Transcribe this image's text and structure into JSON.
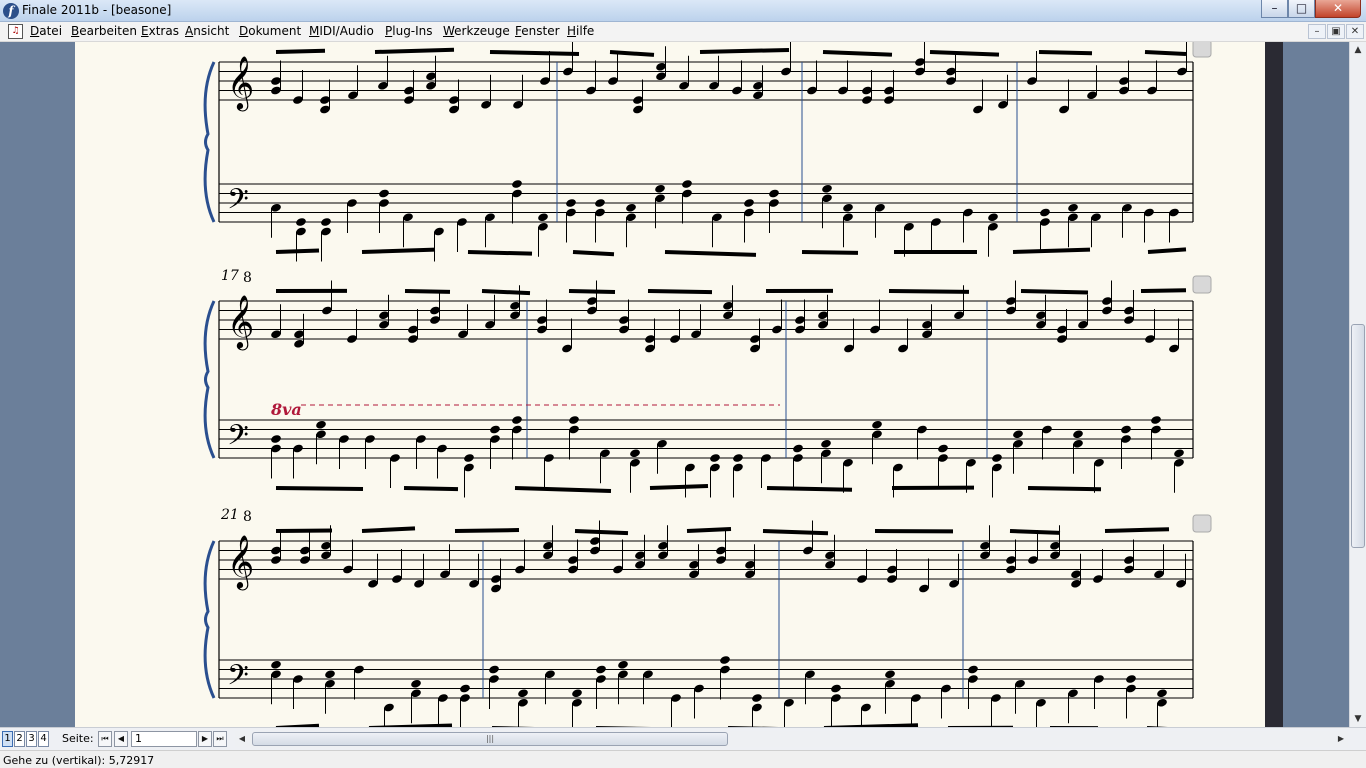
{
  "window": {
    "title": "Finale 2011b - [beasone]",
    "app_icon_glyph": "f",
    "minimize": "–",
    "maximize": "□",
    "close": "✕"
  },
  "menu": {
    "doc_icon": "doc-icon",
    "items": [
      "Datei",
      "Bearbeiten",
      "Extras",
      "Ansicht",
      "Dokument",
      "MIDI/Audio",
      "Plug-Ins",
      "Werkzeuge",
      "Fenster",
      "Hilfe"
    ],
    "mdi_minimize": "–",
    "mdi_restore": "▣",
    "mdi_close": "✕"
  },
  "score": {
    "systems": [
      {
        "measure_number": "",
        "key_marker": ""
      },
      {
        "measure_number": "17",
        "key_marker": "8"
      },
      {
        "measure_number": "21",
        "key_marker": "8"
      }
    ],
    "ottava_text": "8va",
    "accent_color": "#b0183a"
  },
  "statusbar": {
    "page_tabs": [
      "1",
      "2",
      "3",
      "4"
    ],
    "active_tab": "1",
    "page_label": "Seite:",
    "page_value": "1",
    "first_icon": "⏮",
    "prev_icon": "◀",
    "next_icon": "▶",
    "last_icon": "⏭"
  },
  "status_text": "Gehe zu (vertikal): 5,72917"
}
